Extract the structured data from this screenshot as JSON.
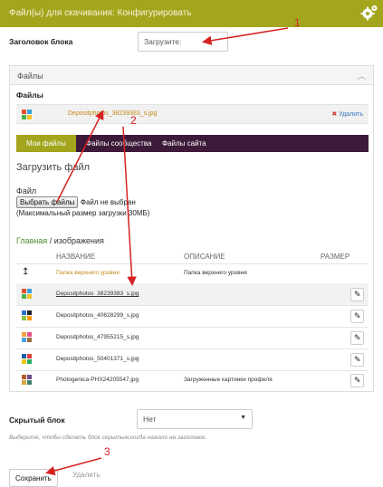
{
  "header": {
    "title": "Файл(ы) для скачивания: Конфигурировать",
    "icon": "gears-icon"
  },
  "block_title": {
    "label": "Заголовок блока",
    "value": "Загрузите:"
  },
  "files_panel": {
    "heading": "Файлы",
    "subheading": "Файлы",
    "attached_file": {
      "name": "Depositphotos_38239383_s.jpg",
      "delete_label": "Удалить"
    },
    "tabs": [
      {
        "label": "Мои файлы",
        "active": true
      },
      {
        "label": "Файлы сообщества",
        "active": false
      },
      {
        "label": "Файлы сайта",
        "active": false
      }
    ],
    "upload": {
      "heading": "Загрузить файл",
      "field_label": "Файл",
      "choose_button": "Выбрать файлы",
      "no_file": "Файл не выбран",
      "max_size": "(Максимальный размер загрузки 30МБ)"
    },
    "breadcrumb": {
      "root": "Главная",
      "separator": " / ",
      "current": "изображения"
    },
    "table": {
      "columns": [
        "НАЗВАНИЕ",
        "ОПИСАНИЕ",
        "РАЗМЕР"
      ],
      "up_row": {
        "name": "Папка верхнего уровня",
        "description": "Папка верхнего уровня"
      },
      "rows": [
        {
          "name": "Depositphotos_38239383_s.jpg",
          "description": "",
          "selected": true
        },
        {
          "name": "Depositphotos_40628299_s.jpg",
          "description": ""
        },
        {
          "name": "Depositphotos_47955215_s.jpg",
          "description": ""
        },
        {
          "name": "Depositphotos_50401371_s.jpg",
          "description": ""
        },
        {
          "name": "Photogenica-PHX24205547.jpg",
          "description": "Загруженные картинки профиля"
        }
      ]
    }
  },
  "hidden_block": {
    "label": "Скрытый блок",
    "value": "Нет",
    "hint": "Выберите, чтобы сделать блок скрытым,когда нажали на заголовок."
  },
  "actions": {
    "save": "Сохранить",
    "delete": "Удалить"
  },
  "annotations": {
    "n1": "1",
    "n2": "2",
    "n3": "3",
    "color": "#d62222"
  },
  "colors": {
    "accent": "#a3a51d",
    "tabs_bg": "#3d1a3a",
    "link": "#c58a1a"
  }
}
